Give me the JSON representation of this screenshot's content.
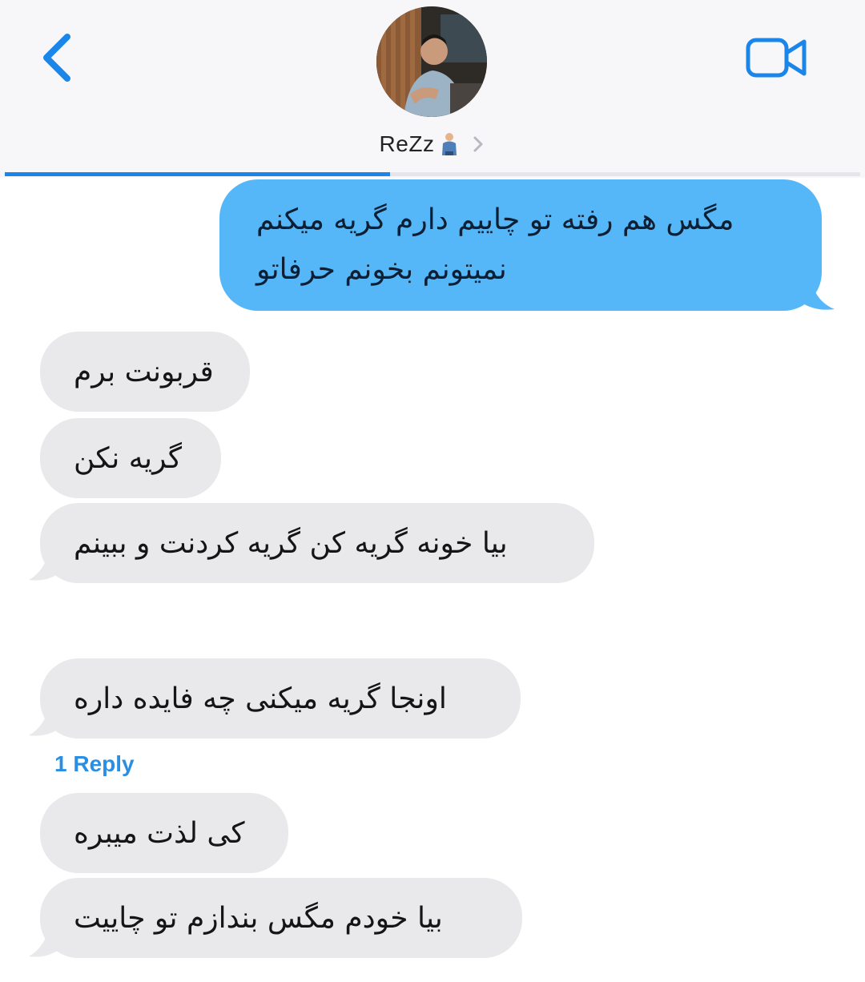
{
  "header": {
    "contact_name": "ReZz",
    "name_emoji": "person-emoji-icon",
    "back_icon": "chevron-left-icon",
    "video_icon": "video-camera-icon",
    "accent_color": "#1a86ea",
    "progress": 0.45
  },
  "messages": {
    "m1": {
      "sender": "me",
      "line1": "مگس هم رفته تو چاییم دارم گریه میکنم",
      "line2": "نمیتونم بخونم حرفاتو"
    },
    "m2": {
      "sender": "contact",
      "text": "قربونت برم"
    },
    "m3": {
      "sender": "contact",
      "text": "گریه نکن"
    },
    "m4": {
      "sender": "contact",
      "text": "بیا خونه گریه کن گریه کردنت و ببینم"
    },
    "m5": {
      "sender": "contact",
      "text": "اونجا گریه میکنی چه فایده داره"
    },
    "m6": {
      "sender": "contact",
      "text": "کی لذت میبره"
    },
    "m7": {
      "sender": "contact",
      "text": "بیا خودم مگس بندازم تو چاییت"
    }
  },
  "reply_link": "1 Reply",
  "colors": {
    "outgoing_bubble": "#55b7f8",
    "incoming_bubble": "#e9e9eb",
    "reply_link": "#2a8fe2"
  }
}
